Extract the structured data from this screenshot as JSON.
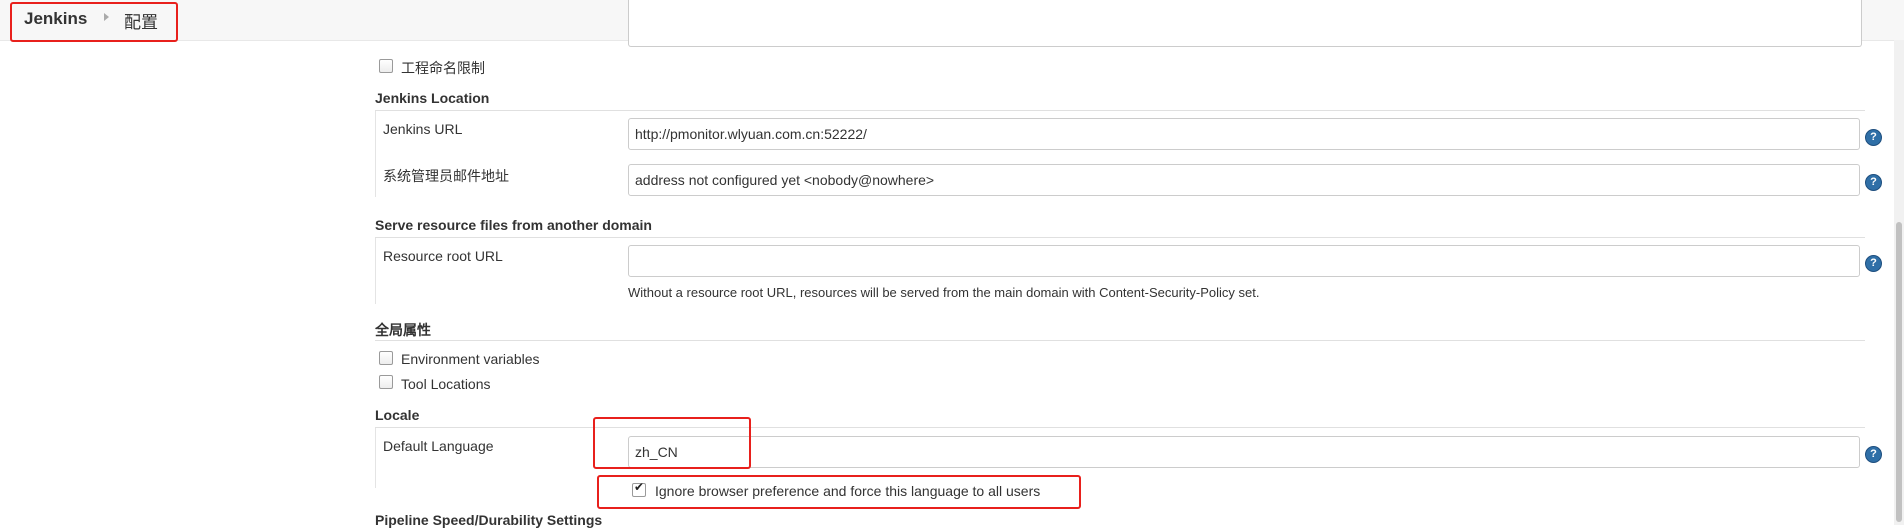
{
  "breadcrumb": {
    "root": "Jenkins",
    "current": "配置"
  },
  "project_naming": {
    "label": "工程命名限制",
    "checked": false
  },
  "jenkins_location": {
    "title": "Jenkins Location",
    "url_label": "Jenkins URL",
    "url_value": "http://pmonitor.wlyuan.com.cn:52222/",
    "email_label": "系统管理员邮件地址",
    "email_value": "address not configured yet <nobody@nowhere>"
  },
  "resource": {
    "title": "Serve resource files from another domain",
    "label": "Resource root URL",
    "value": "",
    "hint": "Without a resource root URL, resources will be served from the main domain with Content-Security-Policy set."
  },
  "global_props": {
    "title": "全局属性",
    "env_label": "Environment variables",
    "tool_label": "Tool Locations"
  },
  "locale": {
    "title": "Locale",
    "lang_label": "Default Language",
    "lang_value": "zh_CN",
    "ignore_label": "Ignore browser preference and force this language to all users",
    "ignore_checked": true
  },
  "pipeline": {
    "title": "Pipeline Speed/Durability Settings"
  },
  "help_glyph": "?",
  "colors": {
    "highlight": "#e8201c",
    "help": "#2f6fa7"
  }
}
